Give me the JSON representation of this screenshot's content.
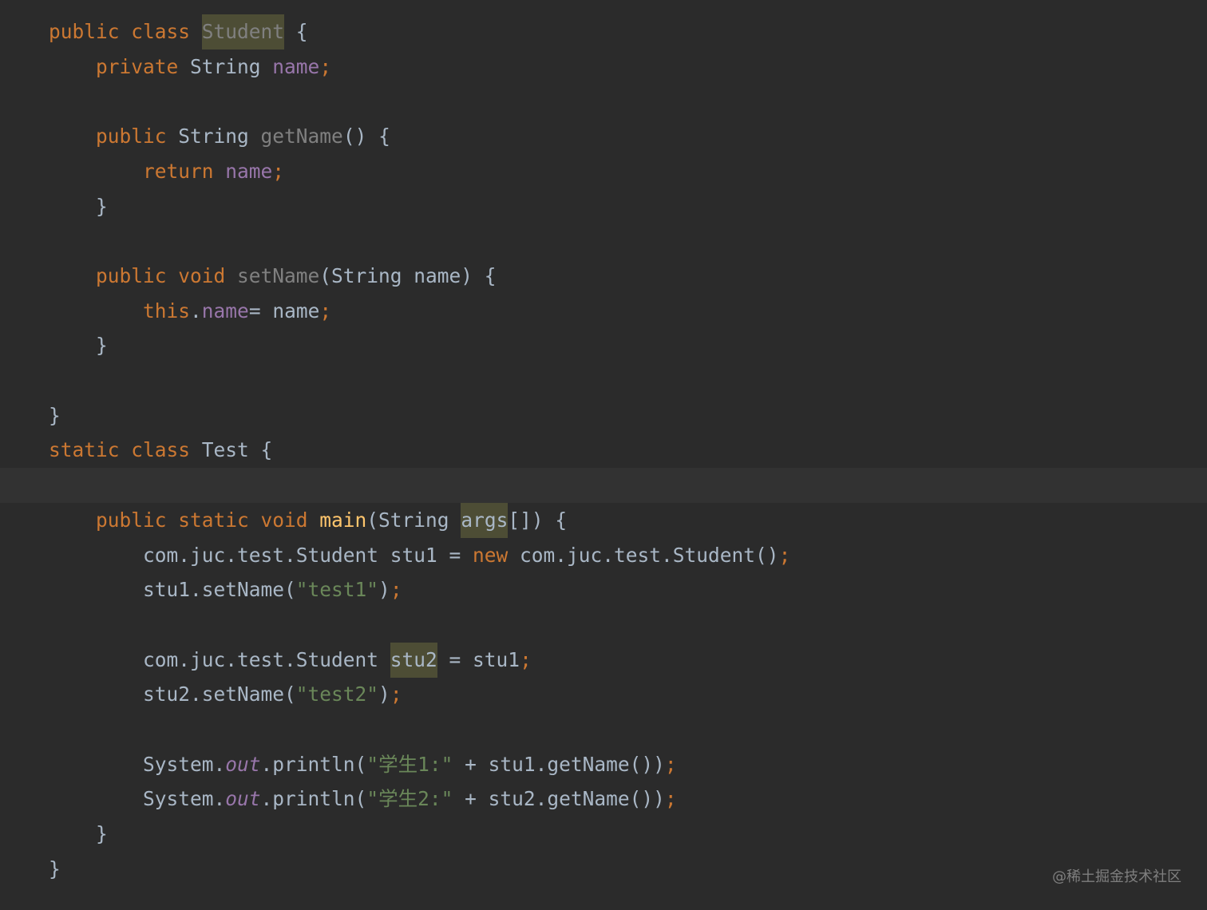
{
  "editor": {
    "theme_colors": {
      "background": "#2b2b2b",
      "current_line": "#323232",
      "keyword": "#cc7832",
      "identifier": "#a9b7c6",
      "field": "#9876aa",
      "method_declaration": "#ffc66d",
      "unused": "#808080",
      "string": "#6a8759",
      "highlight": "#4d4d35"
    },
    "lines": [
      {
        "tokens": [
          {
            "t": "public class ",
            "c": "kw"
          },
          {
            "t": "Student",
            "c": "unused hl"
          },
          {
            "t": " {",
            "c": "plain"
          }
        ]
      },
      {
        "tokens": [
          {
            "t": "    "
          },
          {
            "t": "private ",
            "c": "kw"
          },
          {
            "t": "String ",
            "c": "plain"
          },
          {
            "t": "name",
            "c": "field"
          },
          {
            "t": ";",
            "c": "punc-semi"
          }
        ]
      },
      {
        "tokens": []
      },
      {
        "tokens": [
          {
            "t": "    "
          },
          {
            "t": "public ",
            "c": "kw"
          },
          {
            "t": "String ",
            "c": "plain"
          },
          {
            "t": "getName",
            "c": "unused"
          },
          {
            "t": "() {",
            "c": "plain"
          }
        ]
      },
      {
        "tokens": [
          {
            "t": "        "
          },
          {
            "t": "return ",
            "c": "kw"
          },
          {
            "t": "name",
            "c": "field"
          },
          {
            "t": ";",
            "c": "punc-semi"
          }
        ]
      },
      {
        "tokens": [
          {
            "t": "    }",
            "c": "plain"
          }
        ]
      },
      {
        "tokens": []
      },
      {
        "tokens": [
          {
            "t": "    "
          },
          {
            "t": "public void ",
            "c": "kw"
          },
          {
            "t": "setName",
            "c": "unused"
          },
          {
            "t": "(String name) {",
            "c": "plain"
          }
        ]
      },
      {
        "tokens": [
          {
            "t": "        "
          },
          {
            "t": "this",
            "c": "kw"
          },
          {
            "t": ".",
            "c": "plain"
          },
          {
            "t": "name",
            "c": "field"
          },
          {
            "t": "= name",
            "c": "plain"
          },
          {
            "t": ";",
            "c": "punc-semi"
          }
        ]
      },
      {
        "tokens": [
          {
            "t": "    }",
            "c": "plain"
          }
        ]
      },
      {
        "tokens": []
      },
      {
        "tokens": [
          {
            "t": "}",
            "c": "plain"
          }
        ]
      },
      {
        "tokens": [
          {
            "t": "static class ",
            "c": "kw"
          },
          {
            "t": "Test {",
            "c": "plain"
          }
        ]
      },
      {
        "tokens": [],
        "current": true
      },
      {
        "tokens": [
          {
            "t": "    "
          },
          {
            "t": "public static void ",
            "c": "kw"
          },
          {
            "t": "main",
            "c": "fn-decl"
          },
          {
            "t": "(String ",
            "c": "plain"
          },
          {
            "t": "args",
            "c": "plain hl"
          },
          {
            "t": "[]) {",
            "c": "plain"
          }
        ]
      },
      {
        "tokens": [
          {
            "t": "        "
          },
          {
            "t": "com.juc.test.Student stu1 = ",
            "c": "plain"
          },
          {
            "t": "new ",
            "c": "kw"
          },
          {
            "t": "com.juc.test.Student()",
            "c": "plain"
          },
          {
            "t": ";",
            "c": "punc-semi"
          }
        ]
      },
      {
        "tokens": [
          {
            "t": "        "
          },
          {
            "t": "stu1.setName(",
            "c": "plain"
          },
          {
            "t": "\"test1\"",
            "c": "str"
          },
          {
            "t": ")",
            "c": "plain"
          },
          {
            "t": ";",
            "c": "punc-semi"
          }
        ]
      },
      {
        "tokens": []
      },
      {
        "tokens": [
          {
            "t": "        "
          },
          {
            "t": "com.juc.test.Student ",
            "c": "plain"
          },
          {
            "t": "stu2",
            "c": "plain hl"
          },
          {
            "t": " = stu1",
            "c": "plain"
          },
          {
            "t": ";",
            "c": "punc-semi"
          }
        ]
      },
      {
        "tokens": [
          {
            "t": "        "
          },
          {
            "t": "stu2.setName(",
            "c": "plain"
          },
          {
            "t": "\"test2\"",
            "c": "str"
          },
          {
            "t": ")",
            "c": "plain"
          },
          {
            "t": ";",
            "c": "punc-semi"
          }
        ]
      },
      {
        "tokens": []
      },
      {
        "tokens": [
          {
            "t": "        "
          },
          {
            "t": "System.",
            "c": "plain"
          },
          {
            "t": "out",
            "c": "static-field"
          },
          {
            "t": ".println(",
            "c": "plain"
          },
          {
            "t": "\"学生1:\"",
            "c": "str"
          },
          {
            "t": " + stu1.getName())",
            "c": "plain"
          },
          {
            "t": ";",
            "c": "punc-semi"
          }
        ]
      },
      {
        "tokens": [
          {
            "t": "        "
          },
          {
            "t": "System.",
            "c": "plain"
          },
          {
            "t": "out",
            "c": "static-field"
          },
          {
            "t": ".println(",
            "c": "plain"
          },
          {
            "t": "\"学生2:\"",
            "c": "str"
          },
          {
            "t": " + stu2.getName())",
            "c": "plain"
          },
          {
            "t": ";",
            "c": "punc-semi"
          }
        ]
      },
      {
        "tokens": [
          {
            "t": "    }",
            "c": "plain"
          }
        ]
      },
      {
        "tokens": [
          {
            "t": "}",
            "c": "plain"
          }
        ]
      }
    ]
  },
  "watermark": "@稀土掘金技术社区"
}
